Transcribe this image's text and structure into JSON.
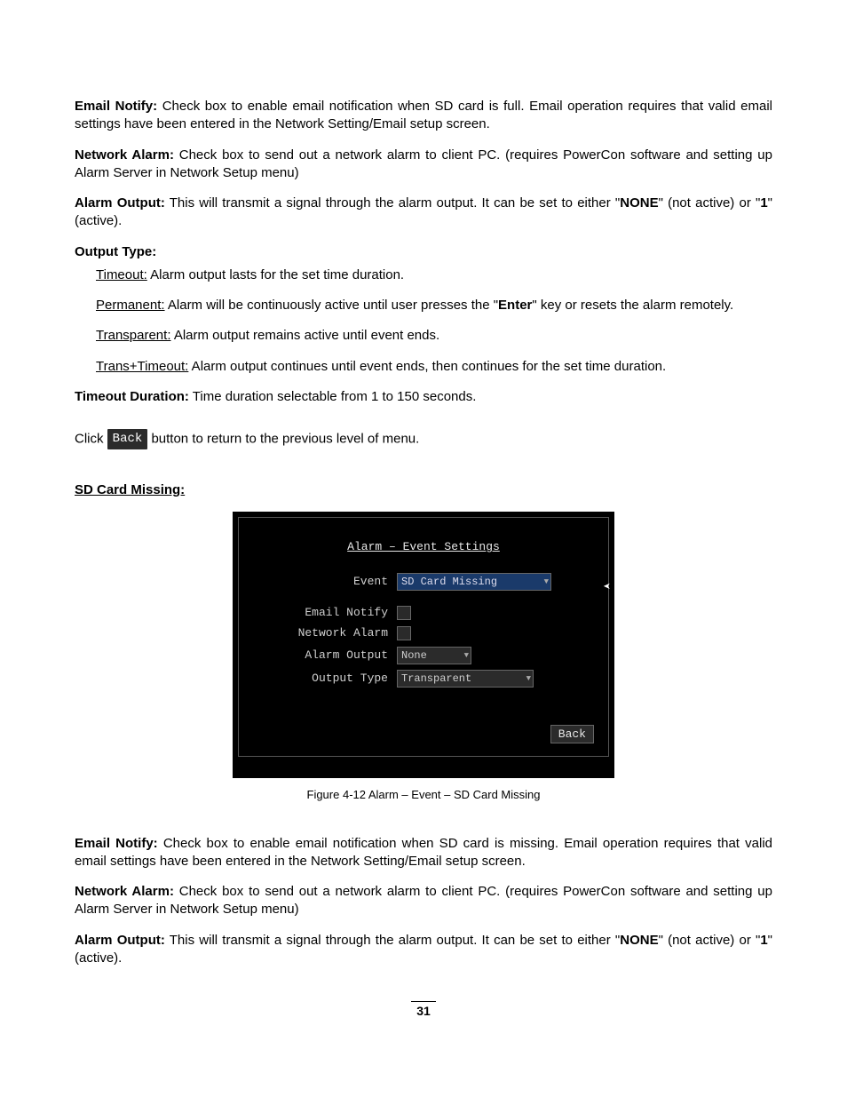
{
  "p1": {
    "emailNotify_label": "Email Notify:",
    "emailNotify_text": " Check box to enable email notification when SD card is full.  Email operation requires that valid email settings have been entered in the Network Setting/Email setup screen.",
    "networkAlarm_label": "Network Alarm:",
    "networkAlarm_text": " Check box to send out a network alarm to client PC. (requires PowerCon software and setting up Alarm Server in Network Setup menu)",
    "alarmOutput_label": "Alarm Output:",
    "alarmOutput_text_a": " This will transmit a signal through the alarm output. It can be set to either \"",
    "alarmOutput_none": "NONE",
    "alarmOutput_text_b": "\" (not active) or \"",
    "alarmOutput_one": "1",
    "alarmOutput_text_c": "\" (active).",
    "outputType_label": "Output Type:",
    "opt_timeout_label": "Timeout:",
    "opt_timeout_text": " Alarm output lasts for the set time duration.",
    "opt_permanent_label": "Permanent:",
    "opt_permanent_text_a": " Alarm will be continuously active until user presses the \"",
    "opt_permanent_enter": "Enter",
    "opt_permanent_text_b": "\" key or resets the alarm remotely.",
    "opt_transparent_label": "Transparent:",
    "opt_transparent_text": " Alarm output remains active until event ends.",
    "opt_transtimeout_label": "Trans+Timeout:",
    "opt_transtimeout_text": " Alarm output continues until event ends, then continues for the set time duration.",
    "timeoutDuration_label": "Timeout Duration:",
    "timeoutDuration_text": " Time duration selectable from 1 to 150 seconds.",
    "click_text_a": "Click  ",
    "click_back": "Back",
    "click_text_b": " button to return to the previous level of menu."
  },
  "section_heading": "SD Card Missing:",
  "shot": {
    "title": "Alarm – Event Settings",
    "event_label": "Event",
    "event_value": "SD Card Missing",
    "emailNotify_label": "Email Notify",
    "networkAlarm_label": "Network Alarm",
    "alarmOutput_label": "Alarm Output",
    "alarmOutput_value": "None",
    "outputType_label": "Output Type",
    "outputType_value": "Transparent",
    "back": "Back"
  },
  "figure_caption": "Figure 4-12 Alarm – Event – SD Card Missing",
  "p2": {
    "emailNotify_label": "Email Notify:",
    "emailNotify_text": " Check box to enable email notification when SD card is missing.  Email operation requires that valid email settings have been entered in the Network Setting/Email setup screen.",
    "networkAlarm_label": "Network Alarm:",
    "networkAlarm_text": " Check box to send out a network alarm to client PC. (requires PowerCon software and setting up Alarm Server in Network Setup menu)",
    "alarmOutput_label": "Alarm Output:",
    "alarmOutput_text_a": " This will transmit a signal through the alarm output. It can be set to either \"",
    "alarmOutput_none": "NONE",
    "alarmOutput_text_b": "\" (not active) or \"",
    "alarmOutput_one": "1",
    "alarmOutput_text_c": "\" (active)."
  },
  "page_number": "31"
}
